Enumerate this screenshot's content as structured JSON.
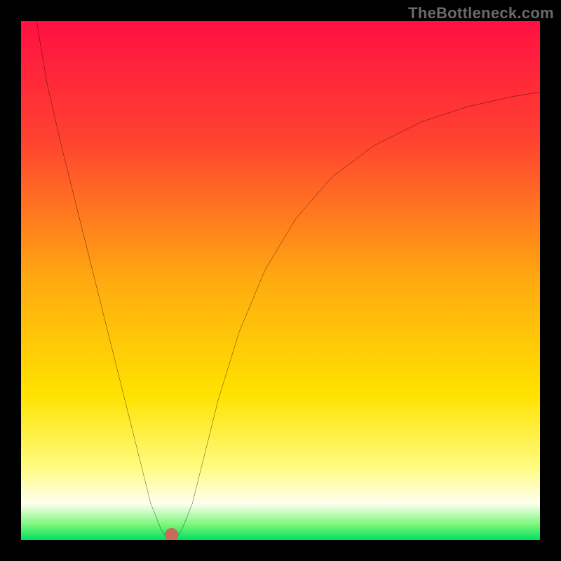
{
  "watermark": "TheBottleneck.com",
  "chart_data": {
    "type": "line",
    "title": "",
    "xlabel": "",
    "ylabel": "",
    "xlim": [
      0,
      100
    ],
    "ylim": [
      0,
      100
    ],
    "grid": false,
    "legend": false,
    "background_gradient": [
      {
        "pos": 0.0,
        "color": "#ff1042"
      },
      {
        "pos": 0.23,
        "color": "#ff4230"
      },
      {
        "pos": 0.5,
        "color": "#ffaa10"
      },
      {
        "pos": 0.72,
        "color": "#ffe200"
      },
      {
        "pos": 0.86,
        "color": "#fffb80"
      },
      {
        "pos": 0.93,
        "color": "#fffff0"
      },
      {
        "pos": 0.97,
        "color": "#7cf77c"
      },
      {
        "pos": 1.0,
        "color": "#00e060"
      }
    ],
    "series": [
      {
        "name": "bottleneck-curve",
        "color": "#000000",
        "x": [
          3,
          5,
          8,
          12,
          16,
          20,
          23,
          25,
          27,
          28,
          29,
          30,
          31,
          33,
          35,
          38,
          42,
          47,
          53,
          60,
          68,
          77,
          86,
          95,
          100
        ],
        "y": [
          100,
          88,
          75,
          59,
          43,
          27,
          15,
          7,
          2,
          0.5,
          0,
          0.5,
          2,
          7,
          15,
          27,
          40,
          52,
          62,
          70,
          76,
          80.5,
          83.5,
          85.5,
          86.3
        ]
      }
    ],
    "markers": [
      {
        "name": "optimal-point",
        "x": 29,
        "y": 1,
        "color": "#c96a5a",
        "r": 1.3
      }
    ]
  }
}
